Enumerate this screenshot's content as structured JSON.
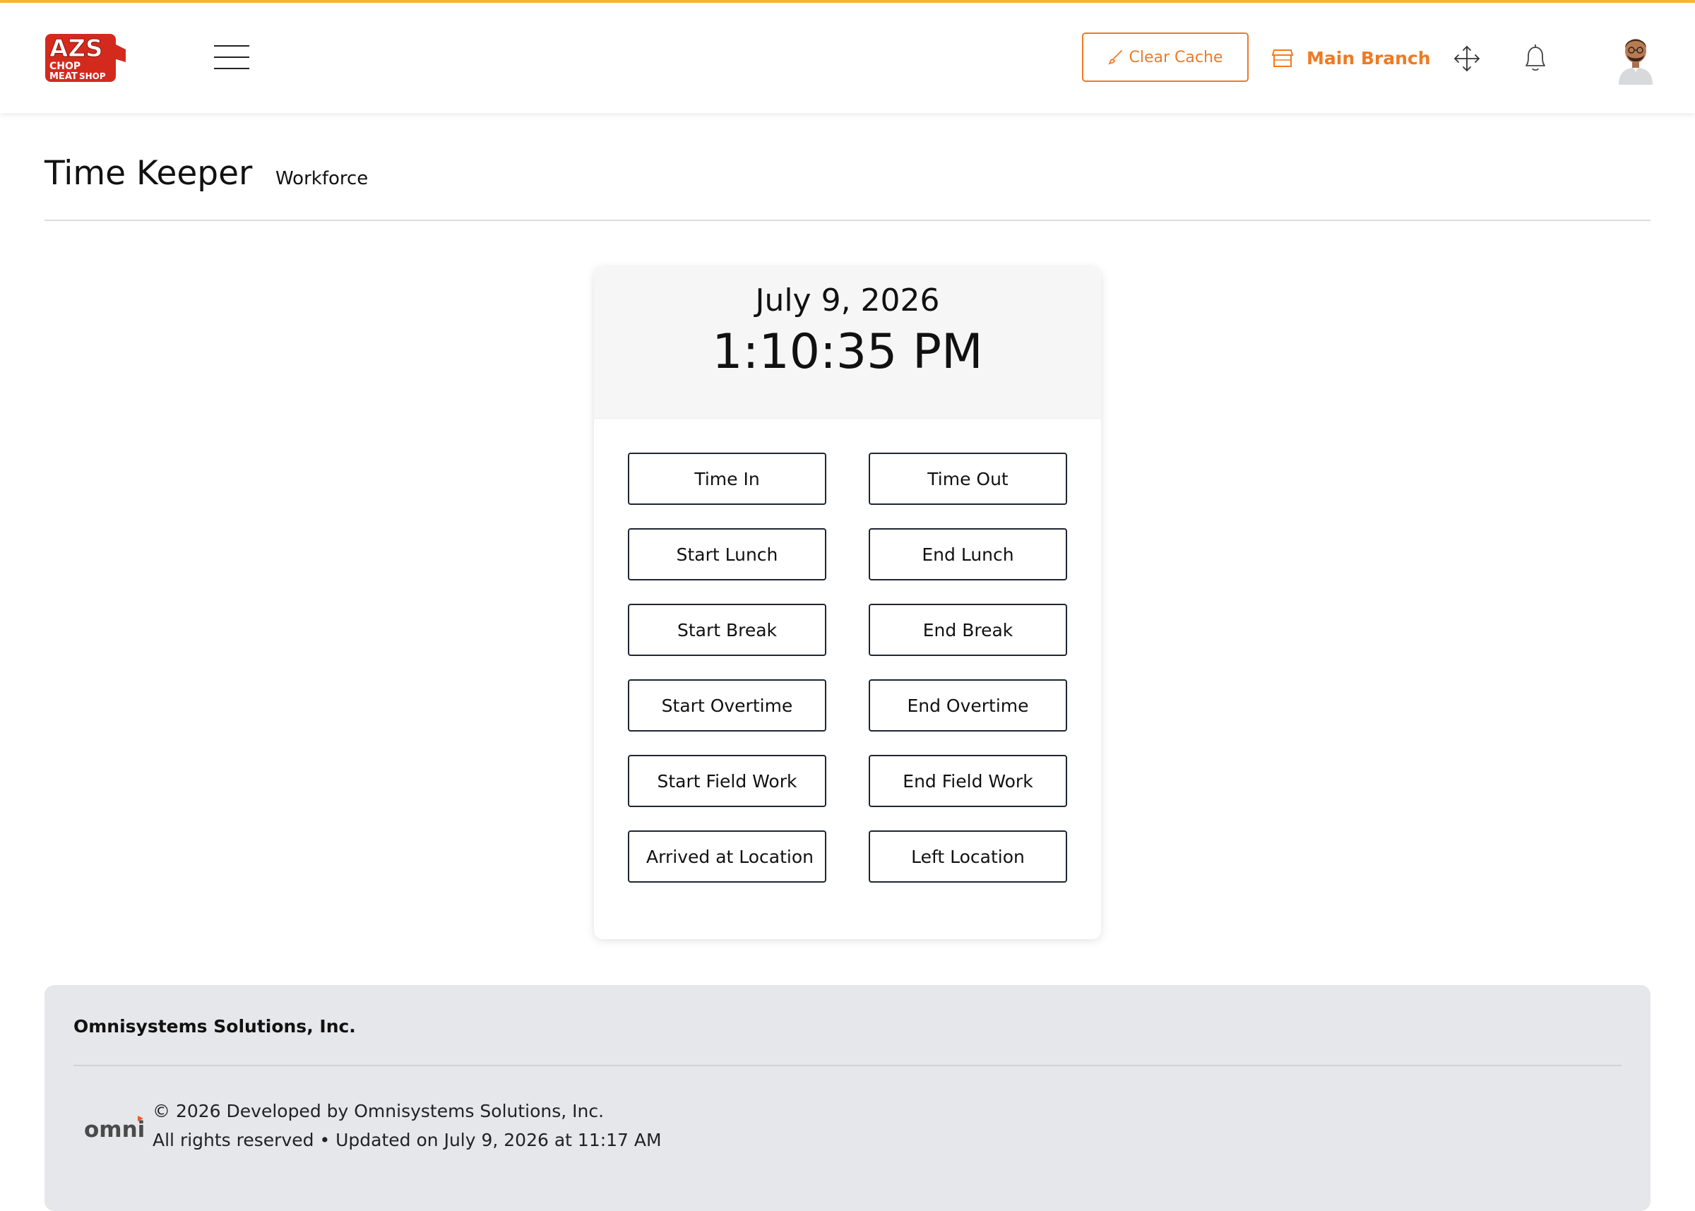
{
  "colors": {
    "accent": "#f07a22",
    "top_stripe": "#f7b733",
    "footer_bg": "#e6e7eb"
  },
  "header": {
    "logo_text": {
      "top": "AZS",
      "bottom_left": "CHOP",
      "bottom_center": "MEAT",
      "bottom_right": "SHOP"
    },
    "clear_cache_label": "Clear Cache",
    "branch_label": "Main Branch",
    "icons": [
      "menu-icon",
      "brush-icon",
      "store-icon",
      "move-icon",
      "bell-icon",
      "user-avatar"
    ]
  },
  "page": {
    "title": "Time Keeper",
    "subtitle": "Workforce"
  },
  "clock": {
    "date": "July 9, 2026",
    "time": "1:10:35 PM"
  },
  "actions": [
    "Time In",
    "Time Out",
    "Start Lunch",
    "End Lunch",
    "Start Break",
    "End Break",
    "Start Overtime",
    "End Overtime",
    "Start Field Work",
    "End Field Work",
    "Arrived at Location",
    "Left Location"
  ],
  "footer": {
    "company": "Omnisystems Solutions, Inc.",
    "logo_text": "omni",
    "copyright": "© 2026 Developed by Omnisystems Solutions, Inc.",
    "updated": "All rights reserved • Updated on July 9, 2026 at 11:17 AM"
  }
}
